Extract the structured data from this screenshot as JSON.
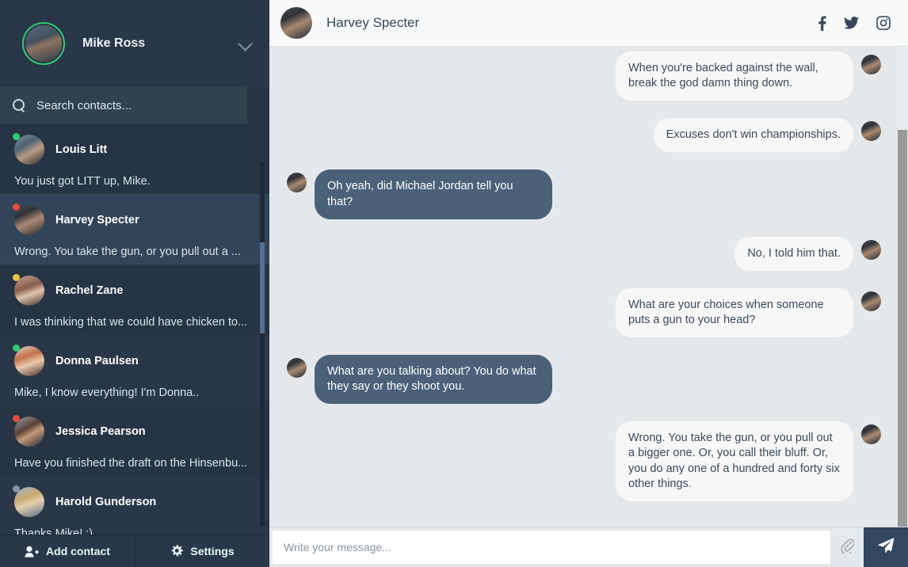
{
  "sidebar": {
    "user": {
      "name": "Mike Ross",
      "avatar": "av-mike",
      "status_color": "#2ecc71",
      "dropdown_icon": "chevron-down-icon"
    },
    "search": {
      "placeholder": "Search contacts...",
      "value": "",
      "icon": "search-icon"
    },
    "contacts": [
      {
        "name": "Louis Litt",
        "preview": "You just got LITT up, Mike.",
        "status_color": "#2ecc71",
        "avatar": "av-louis",
        "selected": false
      },
      {
        "name": "Harvey Specter",
        "preview": "Wrong. You take the gun, or you pull out a ...",
        "status_color": "#e74c3c",
        "avatar": "av-harvey",
        "selected": true
      },
      {
        "name": "Rachel Zane",
        "preview": "I was thinking that we could have chicken to...",
        "status_color": "#e8c породы"
      }
    ],
    "footer": {
      "add_contact_label": "Add contact",
      "add_contact_icon": "user-plus-icon",
      "settings_label": "Settings",
      "settings_icon": "gear-icon"
    }
  },
  "chat": {
    "header": {
      "title": "Harvey Specter",
      "avatar": "av-harvey",
      "socials": [
        {
          "name": "facebook-icon",
          "label": "Facebook"
        },
        {
          "name": "twitter-icon",
          "label": "Twitter"
        },
        {
          "name": "instagram-icon",
          "label": "Instagram"
        }
      ]
    },
    "messages": [
      {
        "direction": "out",
        "text": "When you're backed against the wall, break the god damn thing down.",
        "avatar": "av-harvey"
      },
      {
        "direction": "out",
        "text": "Excuses don't win championships.",
        "avatar": "av-harvey"
      },
      {
        "direction": "in",
        "text": "Oh yeah, did Michael Jordan tell you that?",
        "avatar": "av-harvey"
      },
      {
        "direction": "out",
        "text": "No, I told him that.",
        "avatar": "av-harvey"
      },
      {
        "direction": "out",
        "text": "What are your choices when someone puts a gun to your head?",
        "avatar": "av-harvey"
      },
      {
        "direction": "in",
        "text": "What are you talking about? You do what they say or they shoot you.",
        "avatar": "av-harvey"
      },
      {
        "direction": "out",
        "text": "Wrong. You take the gun, or you pull out a bigger one. Or, you call their bluff. Or, you do any one of a hundred and forty six other things.",
        "avatar": "av-harvey"
      }
    ],
    "composer": {
      "placeholder": "Write your message...",
      "value": "",
      "attach_icon": "paperclip-icon",
      "send_icon": "send-paper-plane-icon"
    }
  },
  "colors": {
    "sidebar_bg": "#273444",
    "sidebar_selected": "#324459",
    "chat_bg": "#e5e8ea",
    "bubble_out": "#f7f7f7",
    "bubble_in": "#4a6179",
    "send_button": "#33475e",
    "online": "#2ecc71",
    "busy": "#e74c3c",
    "away": "#e8c547",
    "offline": "#8c949c"
  }
}
